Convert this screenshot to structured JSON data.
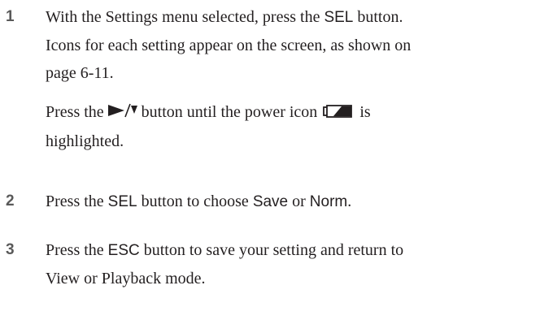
{
  "steps": [
    {
      "number": "1",
      "line1_pre": "With the Settings menu selected, press the ",
      "line1_key": "SEL",
      "line1_post": " button.",
      "line2": "Icons for each setting appear on the screen, as shown on",
      "line3": "page 6-11."
    },
    {
      "number": "2",
      "pre": "Press the ",
      "key": "SEL",
      "mid": " button to choose ",
      "opt1": "Save",
      "or": " or ",
      "opt2": "Norm",
      "end": "."
    },
    {
      "number": "3",
      "pre": "Press the ",
      "key": "ESC",
      "post": " button to save your setting and return to",
      "line2": "View or Playback mode."
    }
  ],
  "sub": {
    "pre": "Press the ",
    "mid": " button until the power icon ",
    "post": " is",
    "line2": "highlighted."
  },
  "icons": {
    "nav": "right-down-arrow-icon",
    "power": "battery-power-icon"
  }
}
